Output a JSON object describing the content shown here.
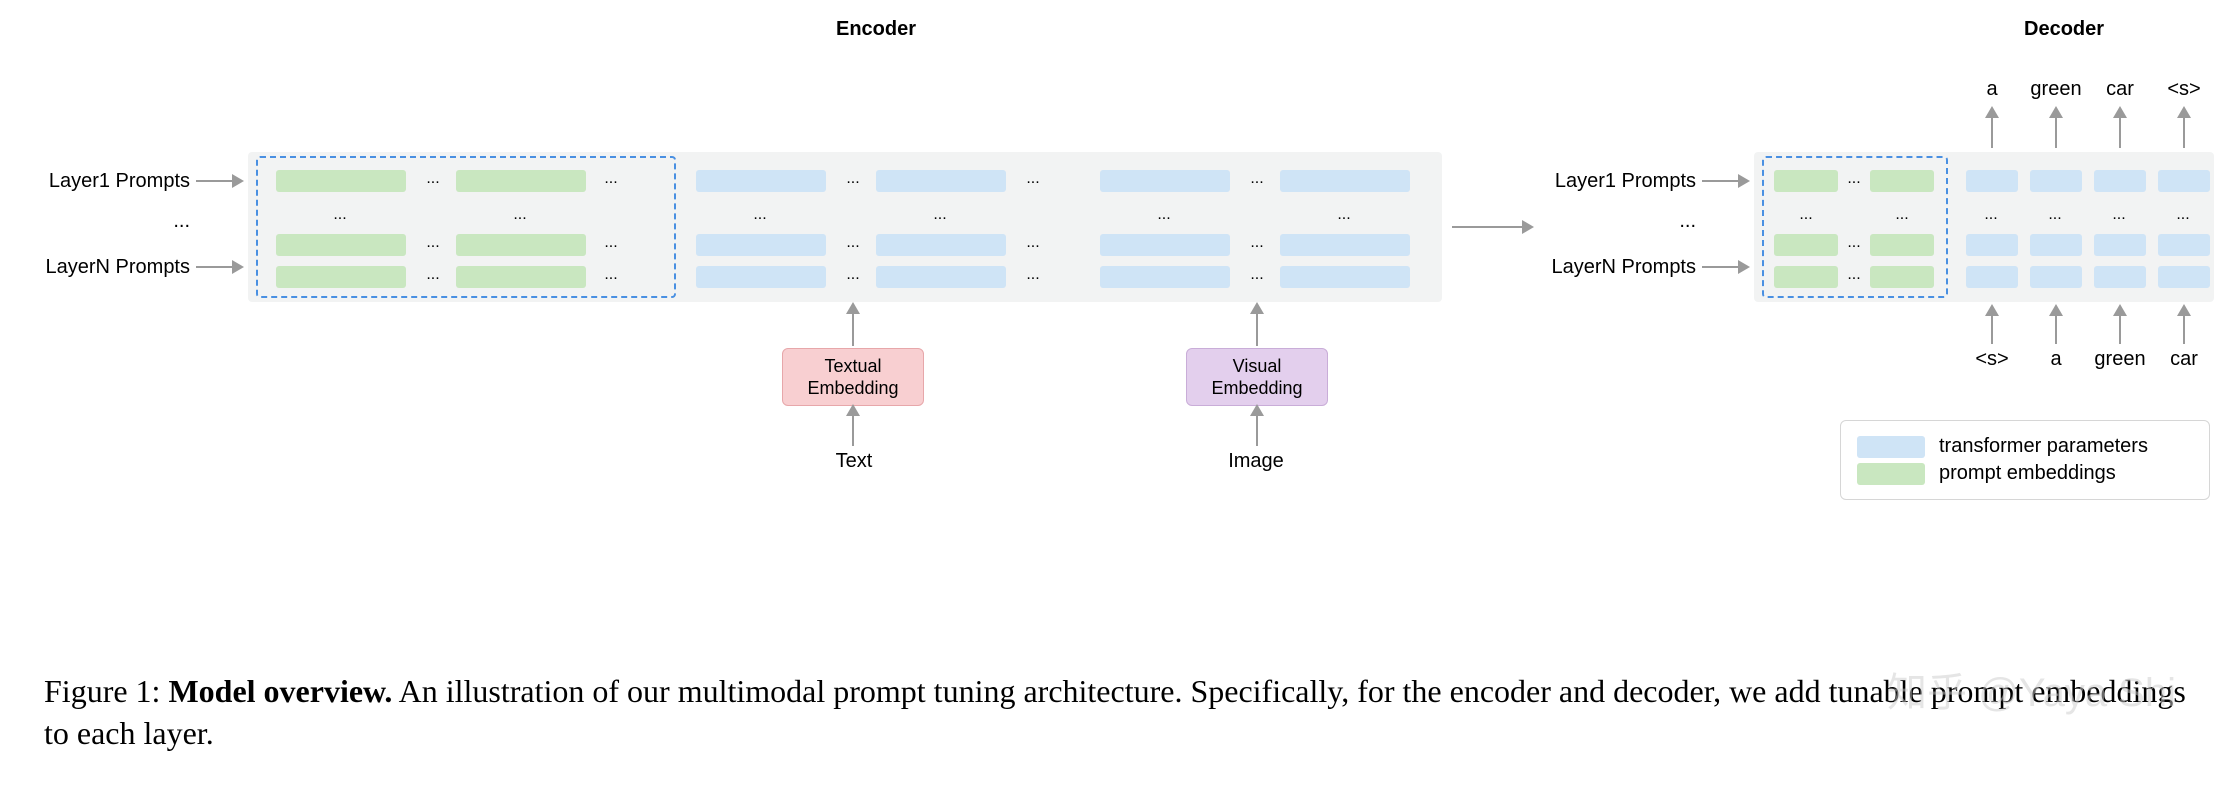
{
  "sections": {
    "encoder_title": "Encoder",
    "decoder_title": "Decoder"
  },
  "labels": {
    "layer1": "Layer1 Prompts",
    "dots": "...",
    "layerN": "LayerN Prompts"
  },
  "inputs": {
    "textual_embedding": "Textual\nEmbedding",
    "visual_embedding": "Visual\nEmbedding",
    "text": "Text",
    "image": "Image"
  },
  "decoder_tokens_top": [
    "a",
    "green",
    "car",
    "<s>"
  ],
  "decoder_tokens_bottom": [
    "<s>",
    "a",
    "green",
    "car"
  ],
  "legend": {
    "transformer": "transformer parameters",
    "prompt": "prompt embeddings"
  },
  "caption": {
    "fig_label": "Figure 1: ",
    "bold": "Model overview.",
    "rest": "  An illustration of our multimodal prompt tuning architecture. Specifically, for the encoder and decoder, we add tunable prompt embeddings to each layer."
  },
  "watermark": "知乎 @Yaya Shi"
}
